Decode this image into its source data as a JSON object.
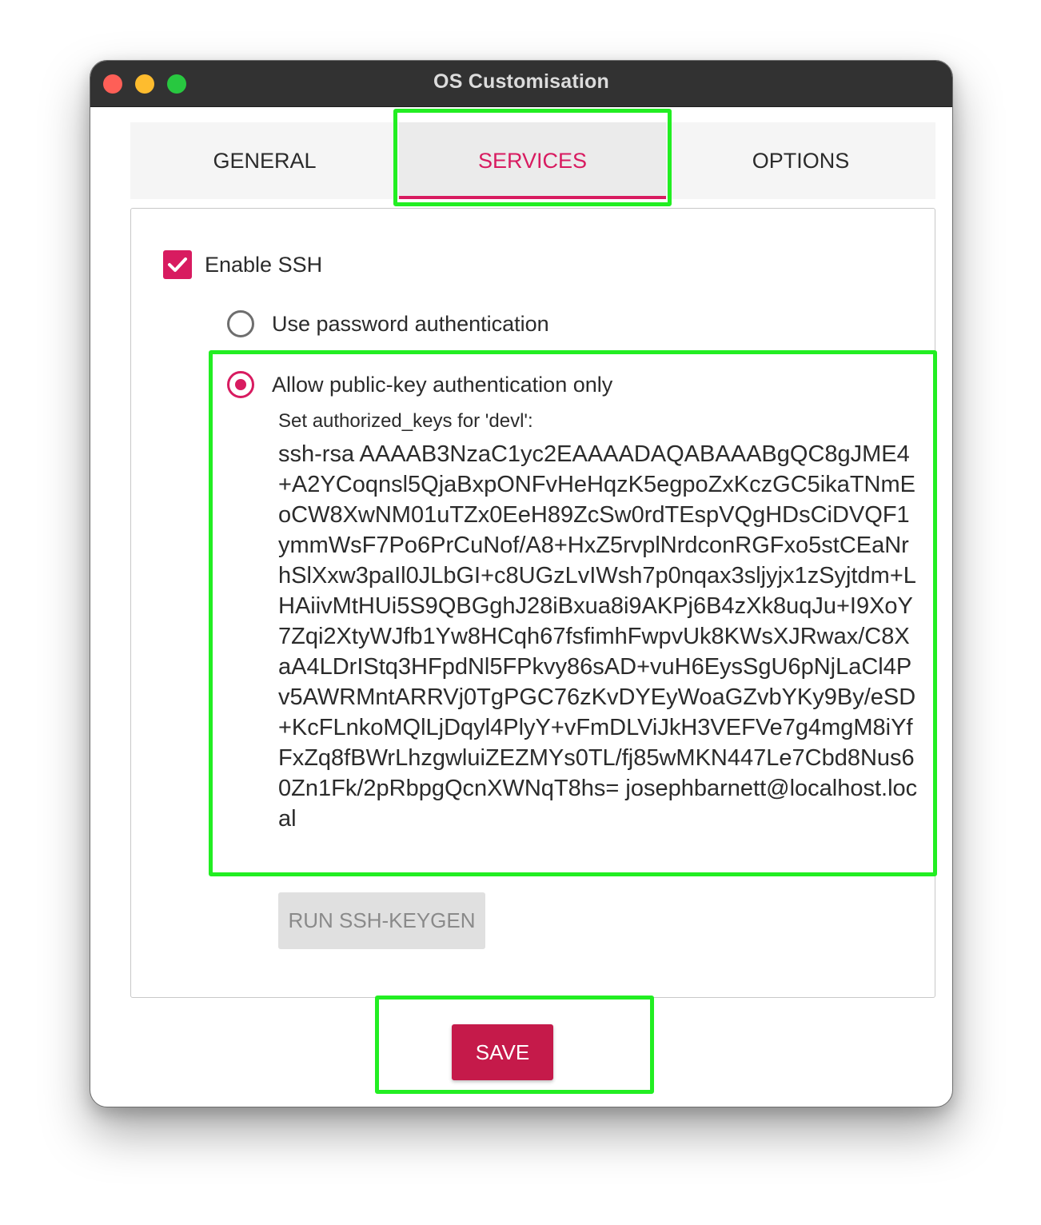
{
  "window": {
    "title": "OS Customisation"
  },
  "tabs": [
    {
      "label": "GENERAL"
    },
    {
      "label": "SERVICES",
      "active": true
    },
    {
      "label": "OPTIONS"
    }
  ],
  "ssh": {
    "enable_label": "Enable SSH",
    "enabled": true,
    "password_auth_label": "Use password authentication",
    "pubkey_auth_label": "Allow public-key authentication only",
    "selected": "pubkey",
    "keys_label": "Set authorized_keys for 'devl':",
    "authorized_keys": "ssh-rsa AAAAB3NzaC1yc2EAAAADAQABAAABgQC8gJME4+A2YCoqnsl5QjaBxpONFvHeHqzK5egpoZxKczGC5ikaTNmEoCW8XwNM01uTZx0EeH89ZcSw0rdTEspVQgHDsCiDVQF1ymmWsF7Po6PrCuNof/A8+HxZ5rvplNrdconRGFxo5stCEaNrhSlXxw3paIl0JLbGI+c8UGzLvIWsh7p0nqax3sljyjx1zSyjtdm+LHAiivMtHUi5S9QBGghJ28iBxua8i9AKPj6B4zXk8uqJu+I9XoY7Zqi2XtyWJfb1Yw8HCqh67fsfimhFwpvUk8KWsXJRwax/C8XaA4LDrIStq3HFpdNl5FPkvy86sAD+vuH6EysSgU6pNjLaCl4Pv5AWRMntARRVj0TgPGC76zKvDYEyWoaGZvbYKy9By/eSD+KcFLnkoMQlLjDqyl4PlyY+vFmDLViJkH3VEFVe7g4mgM8iYfFxZq8fBWrLhzgwluiZEZMYs0TL/fj85wMKN447Le7Cbd8Nus60Zn1Fk/2pRbpgQcnXWNqT8hs= josephbarnett@localhost.local",
    "keygen_label": "RUN SSH-KEYGEN"
  },
  "save_label": "SAVE",
  "colors": {
    "accent": "#d81b60",
    "save_button": "#c51a4a",
    "highlight": "#22ee22",
    "titlebar": "#323232"
  }
}
